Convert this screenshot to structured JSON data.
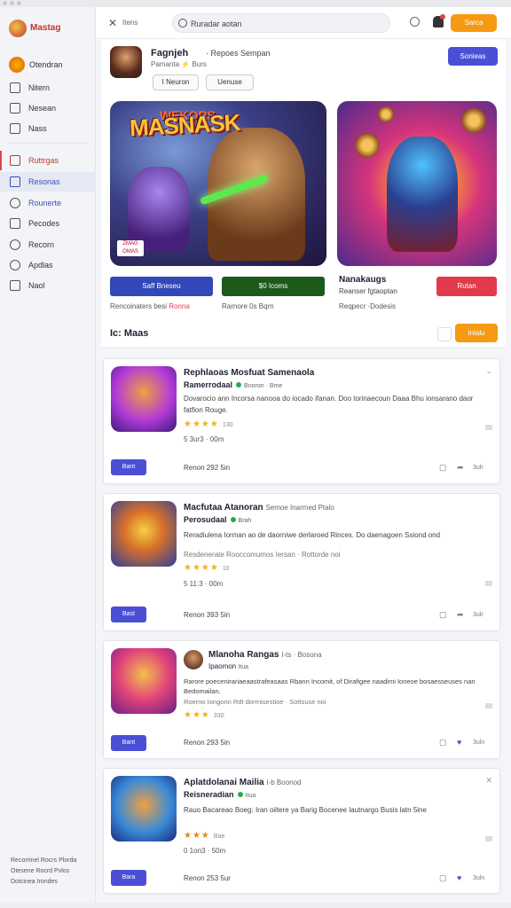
{
  "app": {
    "title": "Mastag"
  },
  "window_top": {
    "left_text": "",
    "right_text": ""
  },
  "topbar": {
    "close_glyph": "✕",
    "tab_label": "Itens",
    "search_value": "Ruradar aotan",
    "action_label": "Sarca"
  },
  "sidebar": {
    "user": "Otendran",
    "items": [
      {
        "label": "Nitern",
        "icon": "home-icon"
      },
      {
        "label": "Nesean",
        "icon": "grid-icon"
      },
      {
        "label": "Nass",
        "icon": "list-icon"
      },
      {
        "label": "Ruttrgas",
        "icon": "home-icon"
      },
      {
        "label": "Resonas",
        "icon": "chat-icon"
      },
      {
        "label": "Rounerte",
        "icon": "gear-icon"
      },
      {
        "label": "Pecodes",
        "icon": "bag-icon"
      },
      {
        "label": "Recorn",
        "icon": "clock-icon"
      },
      {
        "label": "Apdlas",
        "icon": "flag-icon"
      },
      {
        "label": "Naol",
        "icon": "doc-icon"
      }
    ],
    "footer": [
      "Recorrinel Rocrs Plorda",
      "Otesene Rocrd Pvlos",
      "Dotcinea Irondes"
    ]
  },
  "hero": {
    "name": "Fagnjeh",
    "subtitle": "· Repoes Sempan",
    "meta": "Pamanta ⚡ Burs",
    "chips": [
      "I Neuron",
      "Uenuse"
    ],
    "follow_label": "Sonieas",
    "art_title": "MASNASK",
    "art_subtitle": "WEKORS",
    "art_badge": "ZMAG OMAS",
    "btn_blue": "Saff Bneseu",
    "btn_green": "$0 Icoms",
    "cap1": "Rencoinaters besi",
    "cap1_highlight": "Ronna",
    "cap2": "Rarnore 0s Bqrn",
    "side_title": "Nanakaugs",
    "side_sub": "Reanser fgtaoptan",
    "side_cap": "Reqpecr ·Dodesis",
    "btn_red": "Rutan"
  },
  "section": {
    "title": "Ic: Maas",
    "button": "Inlalu"
  },
  "cards": [
    {
      "title": "Rephlaoas Mosfuat Samenaola",
      "line2": "Ramerrodaal",
      "line2_meta": "Bnoron · Bme",
      "desc": "Dovarocio ann Incorsa nanooa do iocado ifanan. Doo torinaecoun Daaa Bhu ionsarano daor fatfion Rouge.",
      "stars": "★★★★",
      "stars_note": "130",
      "stat": "5 3ur3 · 00m",
      "button": "Bant",
      "rating": "Renon 292 5in",
      "action": "3ulr"
    },
    {
      "title": "Macfutaa Atanoran",
      "title_meta": "Semoe Inarmed Ptalo",
      "line2": "Perosudaal",
      "line2_meta": "Brah",
      "desc": "Reradiulena Iorman ao de daorniwe derlaroed Rinces. Do daenagoen Ssiond ond",
      "desc2": "Resdenerate Rooccomumos Iersan · Rottorde noi",
      "stars": "★★★★",
      "stars_note": "10",
      "stat": "5 11:3 · 00m",
      "button": "Bast",
      "rating": "Renon 393 5in",
      "action": "3ulr"
    },
    {
      "title": "Mlanoha Rangas",
      "title_meta": "I-ts · Bosona",
      "line2": "Ipaomon",
      "line2_meta": "Itua",
      "desc": "Rarore poecenirariaeaastrafeasaas Rbann Incomit, of Dirafigee naadimi Ioneoe bosaesseuses nan Bedomailan.",
      "desc2": "Roerno Iongonn Rdt dorrnisestioe · Sottsuse noi",
      "stars": "★★★",
      "stars_note": "330",
      "stat": "",
      "button": "Bant",
      "rating": "Renon 293 5in",
      "action": "3uln"
    },
    {
      "title": "Aplatdolanai Mailia",
      "title_meta": "I-b Boonod",
      "line2": "Reisneradian",
      "line2_meta": "Itua",
      "desc": "Rauo Bacareao Boeg: Iran oiitere ya Barig Bocenee lautnargo Busis latn 5ine",
      "stars": "★★★",
      "stars_note": "Bae",
      "stat": "0 1on3 · 50m",
      "button": "Bara",
      "rating": "Renon 253 5ur",
      "action": "3uln"
    }
  ]
}
